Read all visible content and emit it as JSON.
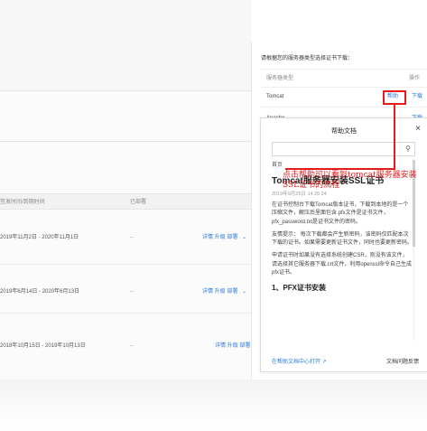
{
  "right_panel": {
    "instruction": "请根据您的服务器类型选择证书下载：",
    "col_type": "服务器类型",
    "col_op": "操作",
    "rows": [
      {
        "name": "Tomcat",
        "help": "帮助",
        "download": "下载"
      },
      {
        "name": "Apache",
        "help": "",
        "download": "下载"
      }
    ]
  },
  "table": {
    "header_time": "签发时间/到期时间",
    "header_status": "已部署",
    "rows": [
      {
        "time": "2019年11月2日 - 2020年11月1日",
        "status": "--",
        "ops": "详情 升级 部署"
      },
      {
        "time": "2019年6月14日 - 2020年6月13日",
        "status": "--",
        "ops": "详情 升级 部署"
      },
      {
        "time": "2018年10月15日 - 2019年10月13日",
        "status": "--",
        "ops": "详情 升级 部署"
      }
    ]
  },
  "modal": {
    "title": "帮助文档",
    "close": "×",
    "search_placeholder": "",
    "crumb": "首页",
    "article_title": "Tomcat服务器安装SSL证书",
    "date": "2019年9月25日 14:26:24",
    "p1": "在证书控制台下载Tomcat版本证书，下载到本地的是一个压缩文件，解压后里面包含.pfx文件是证书文件，pfx_password.txt是证书文件的密码。",
    "p2": "友情提示： 每次下载都会产生新密码，该密码仅匹配本次下载的证书。如果需要更新证书文件，同时也要更新密码。",
    "p3": "申请证书时如果没有选择系统创建CSR，则没有该文件，请选择其它服务器下载.crt文件，利用openssl命令自己生成pfx证书。",
    "h2": "1、PFX证书安装",
    "footer_link": "在帮助文档中心打开",
    "footer_right": "文档问题反馈"
  },
  "annotation": {
    "text": "点击帮助可以看到tomcat服务器安装SSL证书的流程"
  }
}
